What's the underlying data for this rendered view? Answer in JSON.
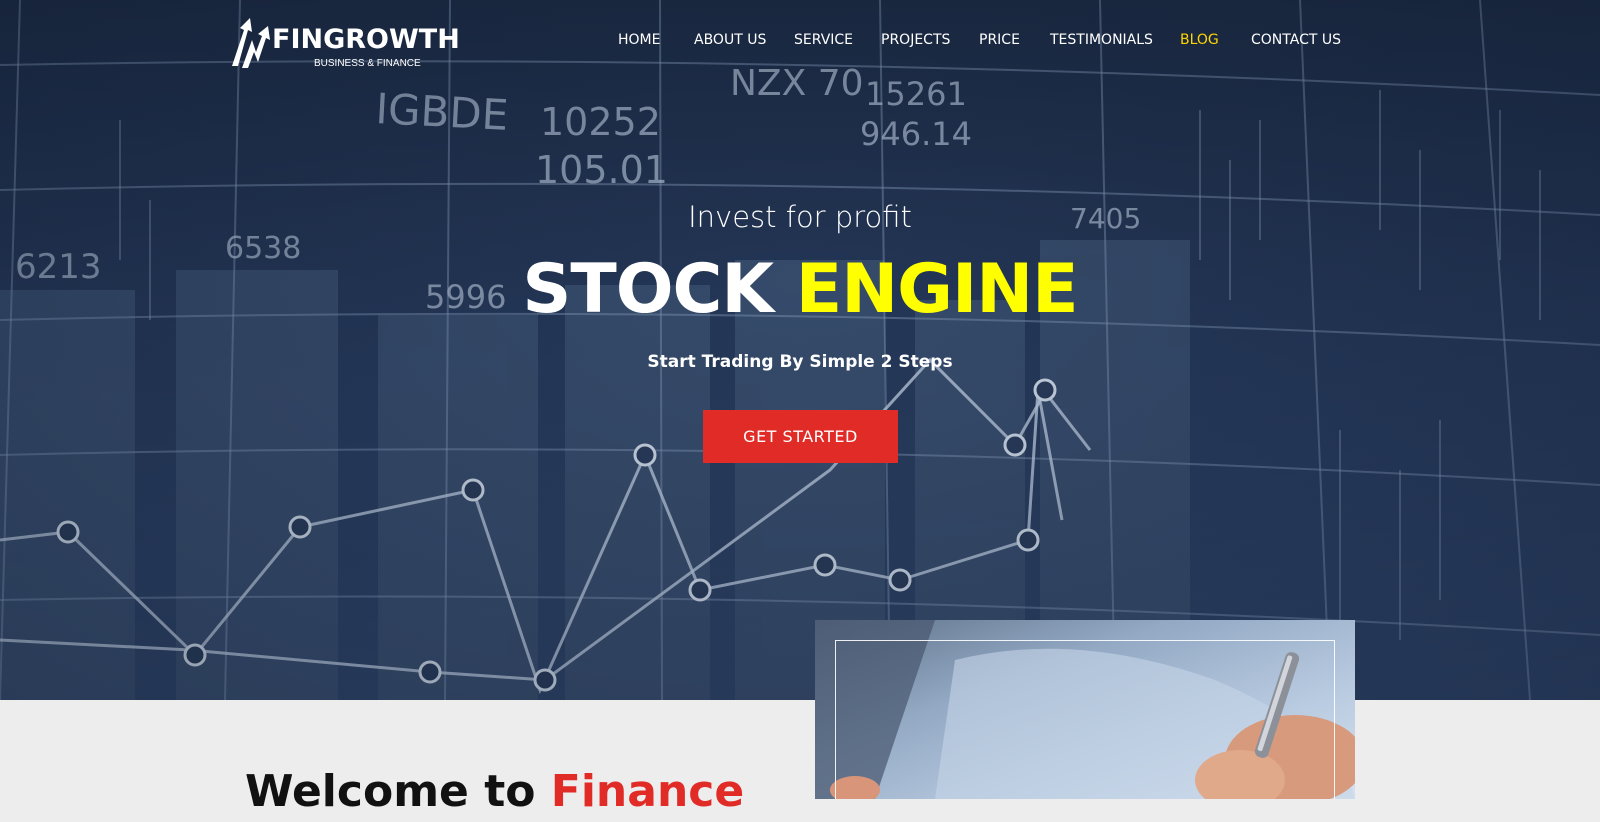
{
  "brand": {
    "name": "FINGROWTH",
    "tagline": "BUSINESS & FINANCE",
    "logo_icon": "logo-mark-icon"
  },
  "nav": {
    "items": [
      {
        "label": "HOME",
        "active": false
      },
      {
        "label": "ABOUT US",
        "active": false
      },
      {
        "label": "SERVICE",
        "active": false
      },
      {
        "label": "PROJECTS",
        "active": false
      },
      {
        "label": "PRICE",
        "active": false
      },
      {
        "label": "TESTIMONIALS",
        "active": false
      },
      {
        "label": "BLOG",
        "active": true
      },
      {
        "label": "CONTACT US",
        "active": false
      }
    ]
  },
  "hero": {
    "subtitle": "Invest for profit",
    "title_white": "STOCK",
    "title_yellow": "ENGINE",
    "tagline": "Start Trading By Simple 2 Steps",
    "cta_label": "GET STARTED",
    "background_figures": [
      "IGBDE",
      "10252",
      "105.01",
      "NZX 70",
      "15261",
      "946.14",
      "6213",
      "6538",
      "5996",
      "7405"
    ]
  },
  "welcome": {
    "text_dark": "Welcome to",
    "text_red": "Finance"
  },
  "colors": {
    "accent_yellow": "#ffff00",
    "active_nav": "#ffd400",
    "cta_red": "#e02b27",
    "hero_dark": "#1c2b44",
    "page_bg": "#ededed"
  }
}
